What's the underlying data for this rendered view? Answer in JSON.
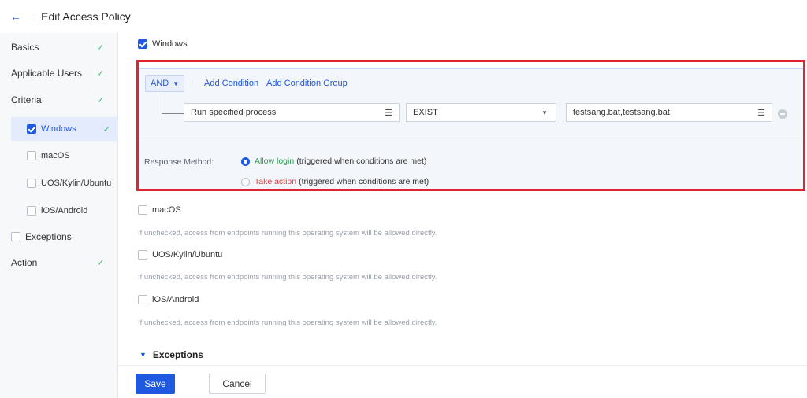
{
  "header": {
    "back_icon": "arrow-left-icon",
    "separator": "|",
    "title": "Edit Access Policy"
  },
  "sidebar": {
    "items": [
      {
        "label": "Basics",
        "checked": true
      },
      {
        "label": "Applicable Users",
        "checked": true
      },
      {
        "label": "Criteria",
        "checked": true
      },
      {
        "label": "Exceptions",
        "checked": false
      },
      {
        "label": "Action",
        "checked": true
      }
    ],
    "sub_items": [
      {
        "label": "Windows",
        "checked": true,
        "active": true
      },
      {
        "label": "macOS",
        "checked": false
      },
      {
        "label": "UOS/Kylin/Ubuntu",
        "checked": false
      },
      {
        "label": "iOS/Android",
        "checked": false
      }
    ]
  },
  "main": {
    "windows_label": "Windows",
    "condition": {
      "operator": "AND",
      "add_condition": "Add Condition",
      "add_condition_group": "Add Condition Group",
      "field": "Run specified process",
      "comparator": "EXIST",
      "value": "testsang.bat,testsang.bat"
    },
    "response": {
      "label": "Response Method:",
      "allow_strong": "Allow login",
      "allow_rest": "(triggered when conditions are met)",
      "take_strong": "Take action",
      "take_rest": "(triggered when conditions are met)",
      "selected": "allow"
    },
    "os_rows": [
      {
        "label": "macOS",
        "hint": "If unchecked, access from endpoints running this operating system will be allowed directly."
      },
      {
        "label": "UOS/Kylin/Ubuntu",
        "hint": "If unchecked, access from endpoints running this operating system will be allowed directly."
      },
      {
        "label": "iOS/Android",
        "hint": "If unchecked, access from endpoints running this operating system will be allowed directly."
      }
    ],
    "exceptions_label": "Exceptions"
  },
  "footer": {
    "save_label": "Save",
    "cancel_label": "Cancel"
  },
  "colors": {
    "accent": "#1e59e0",
    "success": "#2e9e4f",
    "danger": "#e03b3b",
    "highlight_frame": "#e1242f"
  }
}
